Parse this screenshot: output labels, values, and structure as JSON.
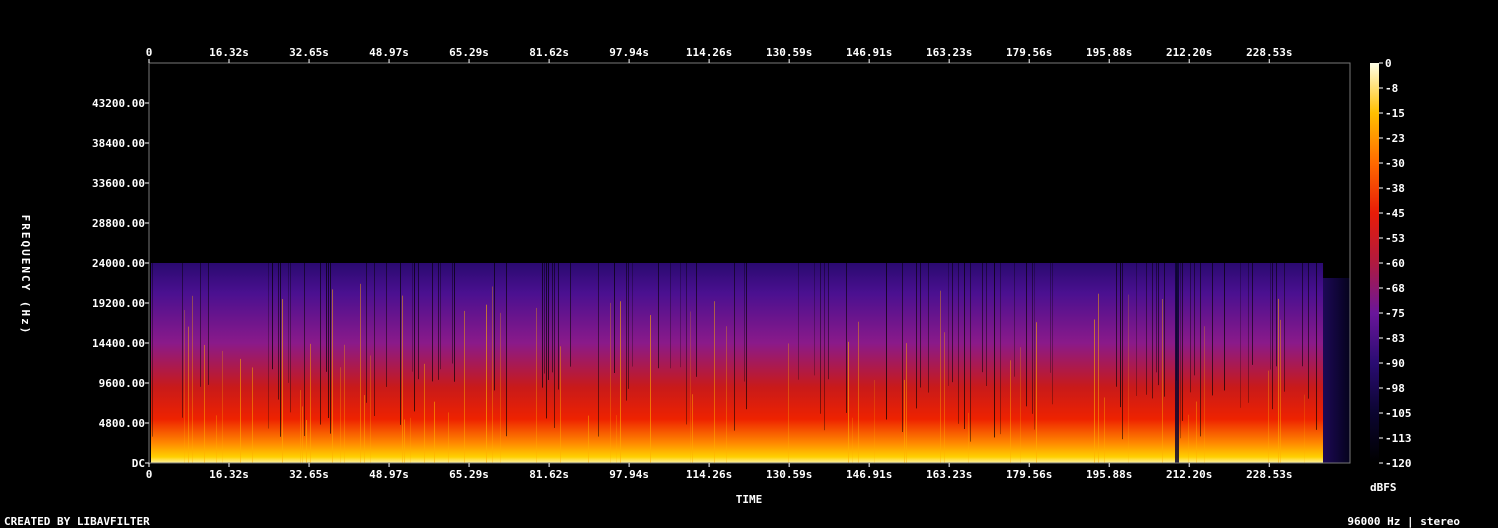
{
  "chart_data": {
    "type": "heatmap",
    "title": "",
    "xlabel": "TIME",
    "ylabel": "FREQUENCY (Hz)",
    "x_unit": "s",
    "xlim": [
      0,
      245
    ],
    "ylim": [
      0,
      48000
    ],
    "x_tick_values": [
      0,
      16.32,
      32.65,
      48.97,
      65.29,
      81.62,
      97.94,
      114.26,
      130.59,
      146.91,
      163.23,
      179.56,
      195.88,
      212.2,
      228.53
    ],
    "x_tick_labels": [
      "0",
      "16.32s",
      "32.65s",
      "48.97s",
      "65.29s",
      "81.62s",
      "97.94s",
      "114.26s",
      "130.59s",
      "146.91s",
      "163.23s",
      "179.56s",
      "195.88s",
      "212.20s",
      "228.53s"
    ],
    "y_tick_values": [
      0,
      4800,
      9600,
      14400,
      19200,
      24000,
      28800,
      33600,
      38400,
      43200
    ],
    "y_tick_labels": [
      "DC",
      "4800.00",
      "9600.00",
      "14400.00",
      "19200.00",
      "24000.00",
      "28800.00",
      "33600.00",
      "38400.00",
      "43200.00"
    ],
    "colorbar": {
      "label": "dBFS",
      "range": [
        -120,
        0
      ],
      "tick_labels": [
        "0",
        "-8",
        "-15",
        "-23",
        "-30",
        "-38",
        "-45",
        "-53",
        "-60",
        "-68",
        "-75",
        "-83",
        "-90",
        "-98",
        "-105",
        "-113",
        "-120"
      ],
      "colors": [
        "#000000",
        "#1a0a4a",
        "#4a0f8f",
        "#8a1f8a",
        "#c81e1e",
        "#ff3300",
        "#ff8800",
        "#ffd000",
        "#ffffc0"
      ]
    },
    "spectral_cutoff_hz": 24000
  },
  "footer": {
    "credit": "CREATED BY LIBAVFILTER",
    "stream_info": "96000 Hz | stereo"
  }
}
